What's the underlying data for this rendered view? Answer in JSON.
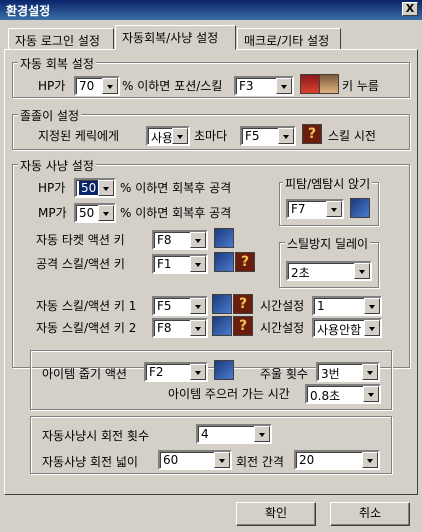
{
  "window": {
    "title": "환경설정",
    "close_label": "X"
  },
  "tabs": [
    "자동 로그인 설정",
    "자동회복/사냥 설정",
    "매크로/기타 설정"
  ],
  "recovery": {
    "group_label": "자동 회복 설정",
    "hp_label": "HP가",
    "hp_value": "70",
    "text_mid": "% 이하면 포션/스킬",
    "key_value": "F3",
    "text_end": "키 누름"
  },
  "follow": {
    "group_label": "졸졸이 설정",
    "target_label": "지정된 케릭에게",
    "use_value": "사용",
    "every_label": "초마다",
    "key_value": "F5",
    "skill_label": "스킬 시전"
  },
  "hunt": {
    "group_label": "자동 사냥 설정",
    "hp_label": "HP가",
    "hp_value": "50",
    "hp_text": "% 이하면 회복후 공격",
    "mp_label": "MP가",
    "mp_value": "50",
    "mp_text": "% 이하면 회복후 공격",
    "target_key_label": "자동 타켓 액션 키",
    "target_key_value": "F8",
    "attack_key_label": "공격 스킬/액션 키",
    "attack_key_value": "F1",
    "skill1_label": "자동 스킬/액션 키 1",
    "skill1_value": "F5",
    "time1_label": "시간설정",
    "time1_value": "1",
    "skill2_label": "자동 스킬/액션 키 2",
    "skill2_value": "F8",
    "time2_label": "시간설정",
    "time2_value": "사용안함",
    "sit_group_label": "피탐/엠탐시 앉기",
    "sit_key_value": "F7",
    "delay_group_label": "스틸방지 딜레이",
    "delay_value": "2초"
  },
  "items": {
    "pickup_label": "아이템 줍기 액션",
    "pickup_value": "F2",
    "count_label": "주울 횟수",
    "count_value": "3번",
    "time_label": "아이템 주으러 가는 시간",
    "time_value": "0.8초"
  },
  "rotation": {
    "count_label": "자동사냥시 회전 횟수",
    "count_value": "4",
    "width_label": "자동사냥 회전 넓이",
    "width_value": "60",
    "interval_label": "회전 간격",
    "interval_value": "20"
  },
  "buttons": {
    "ok": "확인",
    "cancel": "취소"
  }
}
